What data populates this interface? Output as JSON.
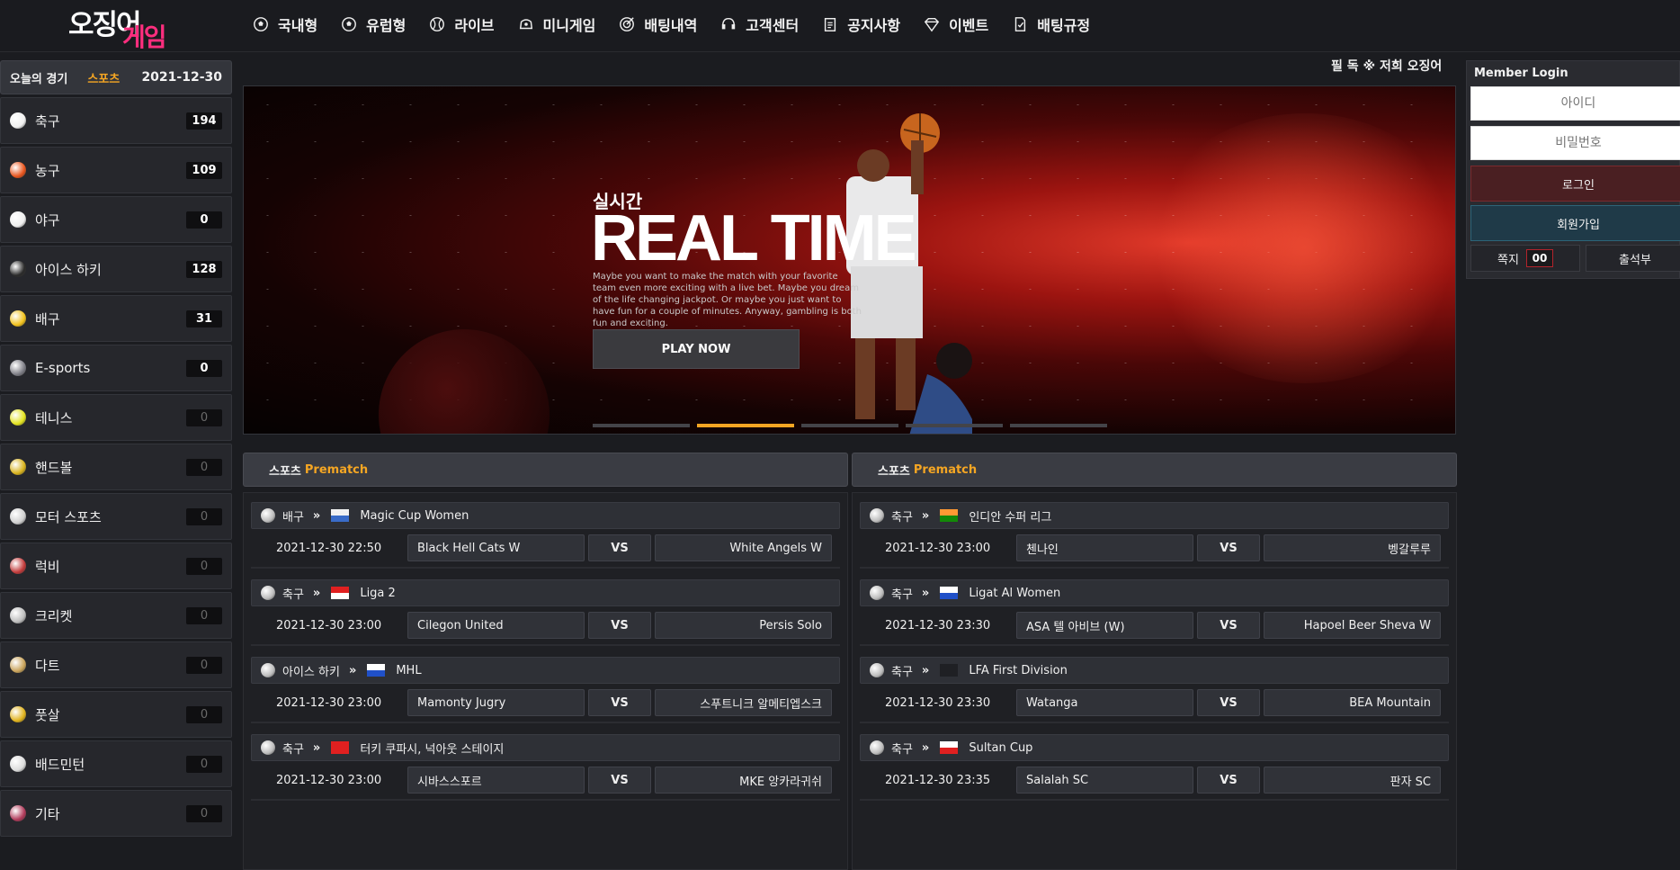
{
  "header": {
    "logo_top": "오징어",
    "logo_bottom": "게임",
    "nav": [
      {
        "label": "국내형",
        "icon": "soccer-ball-icon"
      },
      {
        "label": "유럽형",
        "icon": "soccer-ball-icon"
      },
      {
        "label": "라이브",
        "icon": "tennis-ball-icon"
      },
      {
        "label": "미니게임",
        "icon": "arcade-icon"
      },
      {
        "label": "배팅내역",
        "icon": "target-icon"
      },
      {
        "label": "고객센터",
        "icon": "headset-icon"
      },
      {
        "label": "공지사항",
        "icon": "clipboard-icon"
      },
      {
        "label": "이벤트",
        "icon": "diamond-icon"
      },
      {
        "label": "배팅규정",
        "icon": "rules-icon"
      }
    ]
  },
  "sidebar": {
    "tab_today": "오늘의 경기",
    "tab_sports": "스포츠",
    "date": "2021-12-30",
    "sports": [
      {
        "name": "축구",
        "count": "194"
      },
      {
        "name": "농구",
        "count": "109"
      },
      {
        "name": "야구",
        "count": "0"
      },
      {
        "name": "아이스 하키",
        "count": "128"
      },
      {
        "name": "배구",
        "count": "31"
      },
      {
        "name": "E-sports",
        "count": "0"
      },
      {
        "name": "테니스",
        "count": "0"
      },
      {
        "name": "핸드볼",
        "count": "0"
      },
      {
        "name": "모터 스포츠",
        "count": "0"
      },
      {
        "name": "럭비",
        "count": "0"
      },
      {
        "name": "크리켓",
        "count": "0"
      },
      {
        "name": "다트",
        "count": "0"
      },
      {
        "name": "풋살",
        "count": "0"
      },
      {
        "name": "배드민턴",
        "count": "0"
      },
      {
        "name": "기타",
        "count": "0"
      }
    ]
  },
  "ticker": "필 독 ※ 저희 오징어",
  "banner": {
    "subtitle": "실시간",
    "title": "REAL TIME",
    "desc": "Maybe you want to make the match with your favorite team even more exciting with a live bet. Maybe you dream of the life changing jackpot. Or maybe you just want to have fun for a couple of minutes. Anyway, gambling is both fun and exciting.",
    "button": "PLAY NOW",
    "active_slide": 2,
    "slides": 5
  },
  "prematch_left": {
    "title_a": "스포츠",
    "title_b": "Prematch",
    "matches": [
      {
        "sport": "배구",
        "league": "Magic Cup Women",
        "time": "2021-12-30 22:50",
        "home": "Black Hell Cats W",
        "vs": "VS",
        "away": "White Angels W"
      },
      {
        "sport": "축구",
        "league": "Liga 2",
        "time": "2021-12-30 23:00",
        "home": "Cilegon United",
        "vs": "VS",
        "away": "Persis Solo"
      },
      {
        "sport": "아이스 하키",
        "league": "MHL",
        "time": "2021-12-30 23:00",
        "home": "Mamonty Jugry",
        "vs": "VS",
        "away": "스푸트니크 알메티엡스크"
      },
      {
        "sport": "축구",
        "league": "터키 쿠파시, 넉아웃 스테이지",
        "time": "2021-12-30 23:00",
        "home": "시바스스포르",
        "vs": "VS",
        "away": "MKE 앙카라귀쉬"
      }
    ]
  },
  "prematch_right": {
    "title_a": "스포츠",
    "title_b": "Prematch",
    "matches": [
      {
        "sport": "축구",
        "league": "인디안 수퍼 리그",
        "time": "2021-12-30 23:00",
        "home": "첸나인",
        "vs": "VS",
        "away": "벵갈루루"
      },
      {
        "sport": "축구",
        "league": "Ligat Al Women",
        "time": "2021-12-30 23:30",
        "home": "ASA 텔 아비브 (W)",
        "vs": "VS",
        "away": "Hapoel Beer Sheva W"
      },
      {
        "sport": "축구",
        "league": "LFA First Division",
        "time": "2021-12-30 23:30",
        "home": "Watanga",
        "vs": "VS",
        "away": "BEA Mountain"
      },
      {
        "sport": "축구",
        "league": "Sultan Cup",
        "time": "2021-12-30 23:35",
        "home": "Salalah SC",
        "vs": "VS",
        "away": "판자 SC"
      }
    ]
  },
  "login": {
    "title": "Member Login",
    "id_placeholder": "아이디",
    "pw_placeholder": "비밀번호",
    "login_btn": "로그인",
    "join_btn": "회원가입",
    "msg_label": "쪽지",
    "msg_count": "00",
    "attendance": "출석부"
  }
}
